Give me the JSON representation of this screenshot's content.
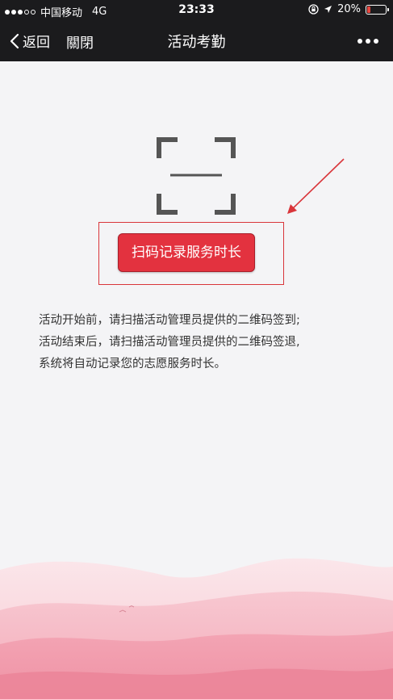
{
  "status_bar": {
    "carrier": "中国移动",
    "network": "4G",
    "time": "23:33",
    "battery": "20%",
    "battery_level": 0.2,
    "signal_bars": 3,
    "signal_total": 5,
    "battery_color": "#e8463f"
  },
  "nav": {
    "back_label": "返回",
    "close_label": "關閉",
    "title": "活动考勤"
  },
  "scan": {
    "button_label": "扫码记录服务时长",
    "icon": "scan-frame-icon",
    "accent_color": "#e3323f"
  },
  "instructions": [
    "活动开始前，请扫描活动管理员提供的二维码签到;",
    "活动结束后，请扫描活动管理员提供的二维码签退,",
    "系统将自动记录您的志愿服务时长。"
  ]
}
